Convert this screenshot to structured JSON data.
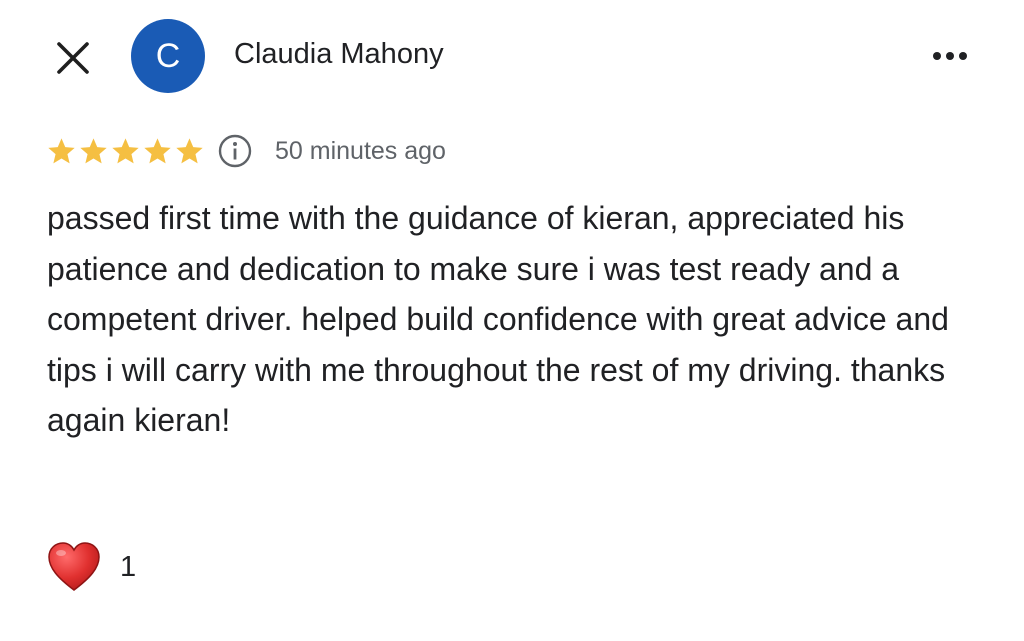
{
  "header": {
    "avatar_letter": "C",
    "avatar_color": "#1a5bb5",
    "author_name": "Claudia Mahony",
    "close_icon": "close-icon",
    "more_icon": "more-horizontal-icon"
  },
  "review": {
    "rating": 5,
    "rating_max": 5,
    "star_color": "#f5bf42",
    "timestamp": "50 minutes ago",
    "text": "passed first time with the guidance of kieran, appreciated his patience and dedication to make sure i was test ready and a competent driver. helped build confidence with great advice and tips i will carry with me throughout the rest of my driving. thanks again kieran!"
  },
  "reactions": {
    "heart_icon": "heart-icon",
    "heart_count": "1"
  }
}
